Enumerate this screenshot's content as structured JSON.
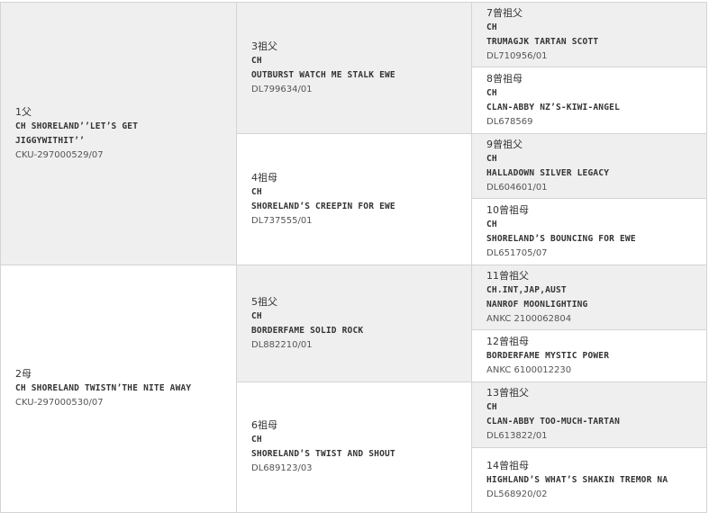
{
  "entries": [
    {
      "pos": "1父",
      "lines": [
        "CH SHORELAND’’LET’S GET",
        "JIGGYWITHIT’’"
      ],
      "reg": "CKU-297000529/07"
    },
    {
      "pos": "2母",
      "lines": [
        "CH SHORELAND TWISTN’THE NITE AWAY"
      ],
      "reg": "CKU-297000530/07"
    },
    {
      "pos": "3祖父",
      "lines": [
        "CH",
        "OUTBURST WATCH ME STALK EWE"
      ],
      "reg": "DL799634/01"
    },
    {
      "pos": "4祖母",
      "lines": [
        "CH",
        "SHORELAND’S CREEPIN FOR EWE"
      ],
      "reg": "DL737555/01"
    },
    {
      "pos": "5祖父",
      "lines": [
        "CH",
        "BORDERFAME SOLID ROCK"
      ],
      "reg": "DL882210/01"
    },
    {
      "pos": "6祖母",
      "lines": [
        "CH",
        "SHORELAND’S TWIST AND SHOUT"
      ],
      "reg": "DL689123/03"
    },
    {
      "pos": "7曾祖父",
      "lines": [
        "CH",
        "TRUMAGJK TARTAN SCOTT"
      ],
      "reg": "DL710956/01"
    },
    {
      "pos": "8曾祖母",
      "lines": [
        "CH",
        "CLAN-ABBY NZ’S-KIWI-ANGEL"
      ],
      "reg": "DL678569"
    },
    {
      "pos": "9曾祖父",
      "lines": [
        "CH",
        "HALLADOWN SILVER LEGACY"
      ],
      "reg": "DL604601/01"
    },
    {
      "pos": "10曾祖母",
      "lines": [
        "CH",
        "SHORELAND’S BOUNCING FOR EWE"
      ],
      "reg": "DL651705/07"
    },
    {
      "pos": "11曾祖父",
      "lines": [
        "CH.INT,JAP,AUST",
        "NANROF MOONLIGHTING"
      ],
      "reg": "ANKC 2100062804"
    },
    {
      "pos": "12曾祖母",
      "lines": [
        "BORDERFAME MYSTIC POWER"
      ],
      "reg": "ANKC 6100012230"
    },
    {
      "pos": "13曾祖父",
      "lines": [
        "CH",
        "CLAN-ABBY TOO-MUCH-TARTAN"
      ],
      "reg": "DL613822/01"
    },
    {
      "pos": "14曾祖母",
      "lines": [
        "HIGHLAND’S WHAT’S SHAKIN TREMOR NA"
      ],
      "reg": "DL568920/02"
    }
  ]
}
